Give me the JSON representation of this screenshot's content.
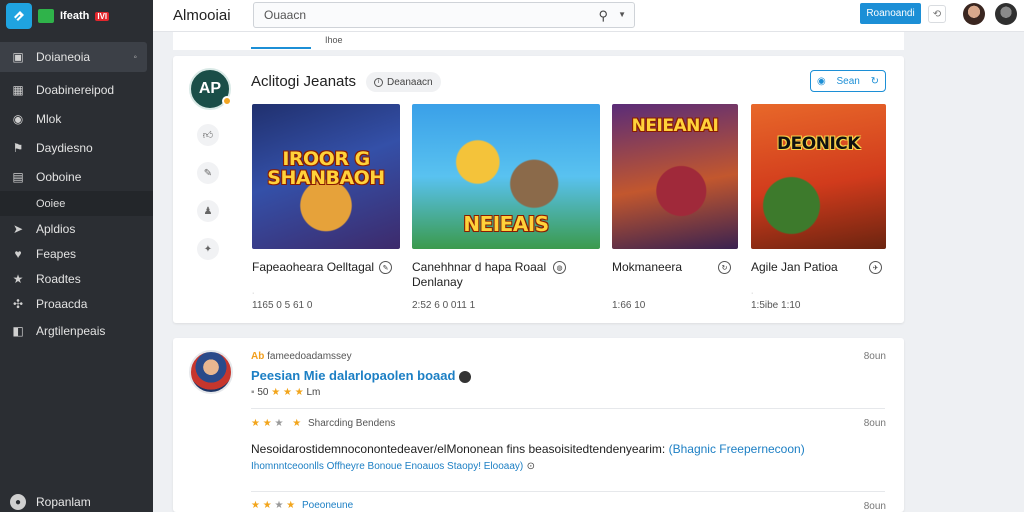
{
  "sidebar": {
    "logo_text": "Ifeath",
    "logo_badge": "IVI",
    "items": [
      {
        "label": "Doianeoia",
        "icon": "box-icon"
      },
      {
        "label": "Doabinereipod",
        "icon": "grid-icon"
      },
      {
        "label": "Mlok",
        "icon": "eye-icon"
      },
      {
        "label": "Daydiesno",
        "icon": "flag-icon"
      },
      {
        "label": "Ooboine",
        "icon": "image-icon"
      },
      {
        "label": "Ooiee"
      },
      {
        "label": "Apldios",
        "icon": "cursor-icon"
      },
      {
        "label": "Feapes",
        "icon": "heart-icon"
      },
      {
        "label": "Roadtes",
        "icon": "star-icon"
      },
      {
        "label": "Proaacda",
        "icon": "network-icon"
      },
      {
        "label": "Argtilenpeais",
        "icon": "panel-icon"
      }
    ],
    "footer_label": "Ropanlam"
  },
  "header": {
    "title": "Almooiai",
    "search_value": "Ouaacn",
    "primary_button": "Roanoandi"
  },
  "tabs": {
    "label": "Ihoe"
  },
  "feature": {
    "brand_initials": "AP",
    "title": "Aclitogi Jeanats",
    "chip_label": "Deanaacn",
    "follow_label": "Sean",
    "games": [
      {
        "name": "Fapeaoheara Oelltagal",
        "cover_text": "IROOR G\nSHANBAOH",
        "meta1": "·",
        "meta2": "1165 0 5 61 0"
      },
      {
        "name": "Canehhnar d hapa Roaal\nDenlanay",
        "cover_text": "NEIEAIS",
        "meta1": "",
        "meta2": "2:52 6 0 011 1"
      },
      {
        "name": "Mokmaneera",
        "cover_text": "NEIEANAI",
        "meta1": "",
        "meta2": "1:66 10"
      },
      {
        "name": "Agile Jan Patioa",
        "cover_text": "DEONICK",
        "meta1": "·",
        "meta2": "1:5ibe 1:10"
      }
    ]
  },
  "reviews": {
    "author_prefix": "Ab",
    "author_rest": "fameedoadamssey",
    "headline": "Peesian Mie dalarlopaolen boaad",
    "first_stars_label": "50",
    "first_stars_tail": "Lm",
    "time1": "8oun",
    "second_label": "Sharcding Bendens",
    "time2": "8oun",
    "body": "Nesoidarostidemnoconontedeaver/elMononean fins beasoisitedtendenyearim:",
    "body_link": "(Bhagnic Freepernecoon)",
    "body_line2": "Ihomnntceoonlls Offheyre Bonoue Enoauos Staopy! Elooaay)",
    "third_label": "Poeoneune",
    "time3": "8oun"
  }
}
